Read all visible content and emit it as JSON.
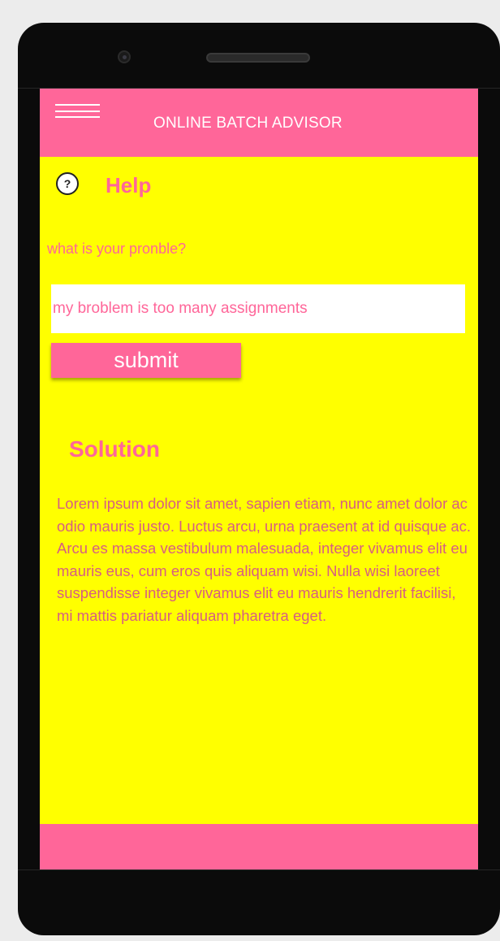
{
  "app": {
    "title": "ONLINE BATCH ADVISOR"
  },
  "help": {
    "icon_glyph": "?",
    "title": "Help"
  },
  "form": {
    "question_label": "what is your pronble?",
    "problem_value": "my broblem is too many assignments",
    "submit_label": "submit"
  },
  "solution": {
    "title": "Solution",
    "body": "Lorem ipsum dolor sit amet, sapien etiam, nunc amet dolor ac odio mauris justo. Luctus arcu, urna praesent at id quisque ac. Arcu es massa vestibulum malesuada, integer vivamus elit eu mauris eus, cum eros quis aliquam wisi. Nulla wisi laoreet suspendisse integer vivamus elit eu mauris hendrerit facilisi, mi mattis pariatur aliquam pharetra eget."
  },
  "colors": {
    "accent": "#ff6699",
    "background": "#ffff00",
    "device": "#0b0b0b"
  },
  "icons": [
    "hamburger-menu-icon",
    "help-icon",
    "camera-icon",
    "speaker-icon"
  ]
}
